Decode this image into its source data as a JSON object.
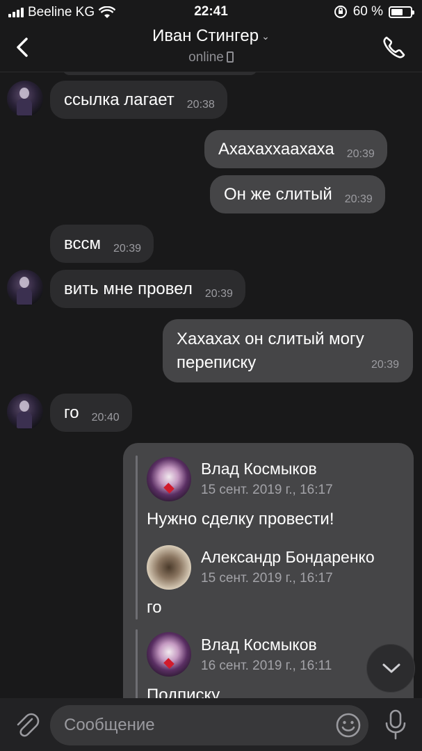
{
  "status_bar": {
    "carrier": "Beeline KG",
    "time": "22:41",
    "battery_percent": "60 %",
    "battery_level": 0.6
  },
  "header": {
    "contact_name": "Иван Стингер",
    "status": "online"
  },
  "messages": [
    {
      "direction": "in",
      "text": "ссылка лагает",
      "time": "20:38"
    },
    {
      "direction": "out",
      "text": "Ахахаххаахаха",
      "time": "20:39"
    },
    {
      "direction": "out",
      "text": "Он же слитый",
      "time": "20:39"
    },
    {
      "direction": "in",
      "text": "вссм",
      "time": "20:39"
    },
    {
      "direction": "in",
      "text": "вить мне провел",
      "time": "20:39"
    },
    {
      "direction": "out",
      "text": "Хахахах он слитый могу переписку",
      "time": "20:39"
    },
    {
      "direction": "in",
      "text": "го",
      "time": "20:40"
    }
  ],
  "forwarded": [
    {
      "author": "Влад Космыков",
      "date": "15 сент. 2019 г., 16:17",
      "text": "Нужно сделку провести!"
    },
    {
      "author": "Александр Бондаренко",
      "date": "15 сент. 2019 г., 16:17",
      "text": "го"
    },
    {
      "author": "Влад Космыков",
      "date": "16 сент. 2019 г., 16:11",
      "text": "Подписку"
    }
  ],
  "input": {
    "placeholder": "Сообщение"
  }
}
